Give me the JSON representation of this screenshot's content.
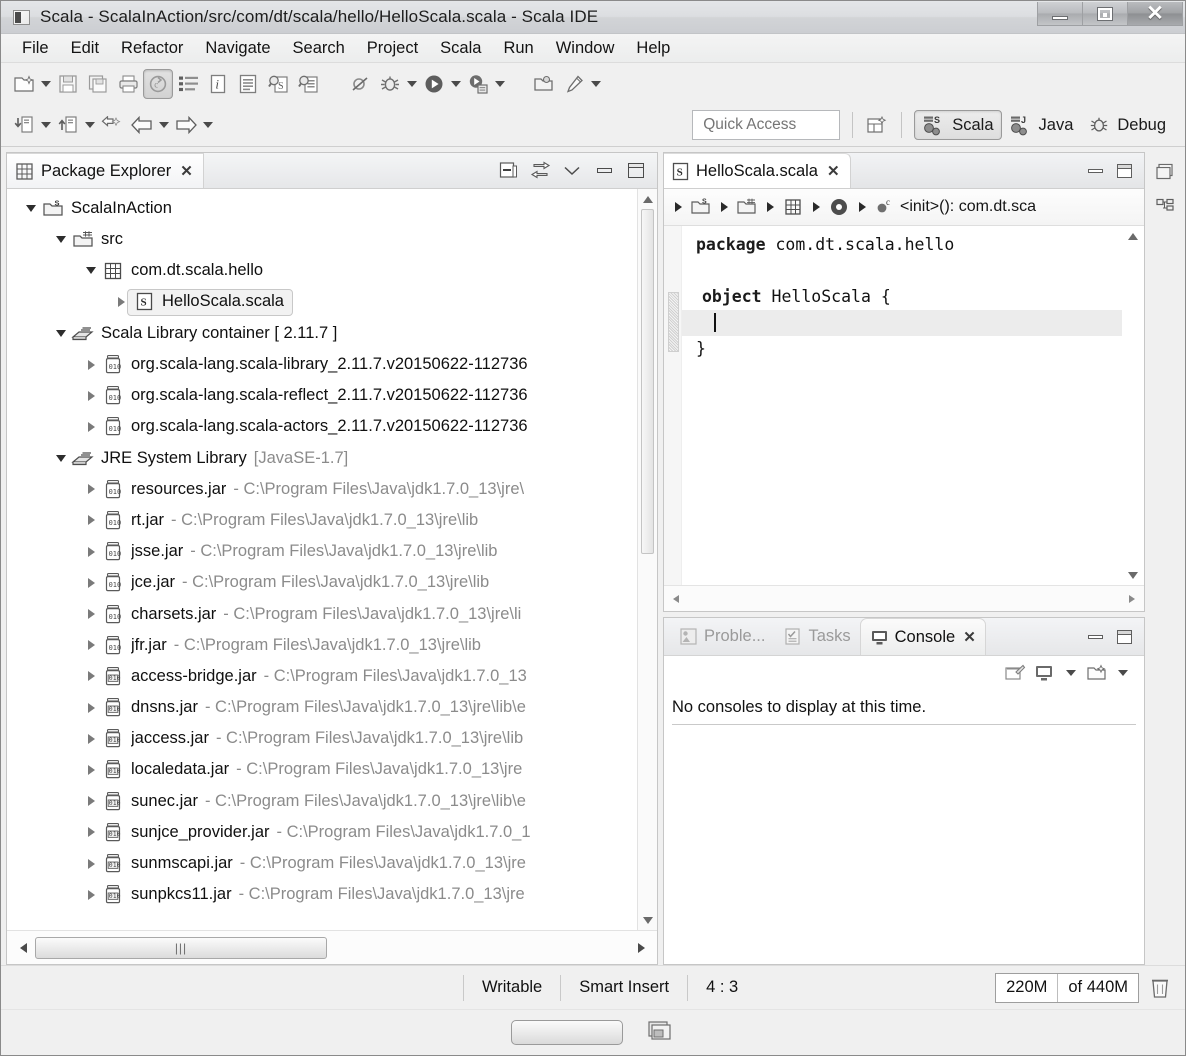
{
  "window": {
    "title": "Scala - ScalaInAction/src/com/dt/scala/hello/HelloScala.scala - Scala IDE",
    "app_icon": "app-window-icon",
    "controls": {
      "minimize": "minimize-icon",
      "maximize": "maximize-icon",
      "close": "✕"
    }
  },
  "menubar": {
    "items": [
      {
        "label": "File"
      },
      {
        "label": "Edit"
      },
      {
        "label": "Refactor"
      },
      {
        "label": "Navigate"
      },
      {
        "label": "Search"
      },
      {
        "label": "Project"
      },
      {
        "label": "Scala"
      },
      {
        "label": "Run"
      },
      {
        "label": "Window"
      },
      {
        "label": "Help"
      }
    ]
  },
  "toolbar": {
    "row1": [
      {
        "name": "new-wizard-button",
        "icon": "new-file-icon",
        "dropdown": true,
        "pressed": false
      },
      {
        "name": "save-button",
        "icon": "save-icon",
        "dropdown": false,
        "pressed": false
      },
      {
        "name": "save-all-button",
        "icon": "save-all-icon",
        "dropdown": false,
        "pressed": false
      },
      {
        "name": "print-button",
        "icon": "print-icon",
        "dropdown": false,
        "pressed": false
      },
      {
        "name": "build-all-button",
        "icon": "build-icon",
        "dropdown": false,
        "pressed": true
      },
      {
        "name": "toggle-markers-button",
        "icon": "list-icon",
        "dropdown": false,
        "pressed": false
      },
      {
        "name": "open-task-button",
        "icon": "info-icon",
        "dropdown": false,
        "pressed": false
      },
      {
        "name": "new-scala-file-button",
        "icon": "document-icon",
        "dropdown": false,
        "pressed": false
      },
      {
        "name": "search-type-button",
        "icon": "search-type-icon",
        "dropdown": false,
        "pressed": false
      },
      {
        "name": "search-package-button",
        "icon": "search-package-icon",
        "dropdown": false,
        "pressed": false
      }
    ],
    "row1_right": [
      {
        "name": "skip-breakpoints-button",
        "icon": "skip-breakpoints-icon",
        "dropdown": false
      },
      {
        "name": "debug-button",
        "icon": "debug-bug-icon",
        "dropdown": true
      },
      {
        "name": "run-button",
        "icon": "run-play-icon",
        "dropdown": true
      },
      {
        "name": "external-tools-button",
        "icon": "external-tools-icon",
        "dropdown": true
      },
      {
        "name": "open-perspective-button",
        "icon": "open-perspective-icon",
        "dropdown": false
      },
      {
        "name": "pin-editor-button",
        "icon": "pin-icon",
        "dropdown": true
      }
    ],
    "row2": [
      {
        "name": "new-scala-project-button",
        "icon": "scala-project-down-icon",
        "dropdown": true
      },
      {
        "name": "new-scala-class-button",
        "icon": "scala-class-up-icon",
        "dropdown": true
      },
      {
        "name": "previous-annotation-button",
        "icon": "prev-annotation-icon",
        "dropdown": false
      },
      {
        "name": "back-button",
        "icon": "back-arrow-icon",
        "dropdown": true
      },
      {
        "name": "forward-button",
        "icon": "forward-arrow-icon",
        "dropdown": true
      }
    ]
  },
  "quick_access": {
    "placeholder": "Quick Access",
    "value": ""
  },
  "perspectives": {
    "open_perspective_icon": "open-perspective-icon",
    "items": [
      {
        "label": "Scala",
        "icon": "scala-perspective-icon",
        "active": true
      },
      {
        "label": "Java",
        "icon": "java-perspective-icon",
        "active": false
      },
      {
        "label": "Debug",
        "icon": "debug-perspective-icon",
        "active": false
      }
    ]
  },
  "package_explorer": {
    "title": "Package Explorer",
    "tab_close": "✕",
    "tools": [
      {
        "name": "collapse-all-button",
        "icon": "collapse-all-icon"
      },
      {
        "name": "link-with-editor-button",
        "icon": "link-editor-icon"
      },
      {
        "name": "view-menu-button",
        "icon": "chevron-down-icon"
      },
      {
        "name": "minimize-view-button",
        "icon": "minimize-icon"
      },
      {
        "name": "maximize-view-button",
        "icon": "maximize-icon"
      }
    ],
    "tree": [
      {
        "depth": 0,
        "arrow": "down",
        "icon": "scala-project-icon",
        "label": "ScalaInAction",
        "detail": "",
        "selected": false
      },
      {
        "depth": 1,
        "arrow": "down",
        "icon": "source-folder-icon",
        "label": "src",
        "detail": "",
        "selected": false
      },
      {
        "depth": 2,
        "arrow": "down",
        "icon": "package-icon",
        "label": "com.dt.scala.hello",
        "detail": "",
        "selected": false
      },
      {
        "depth": 3,
        "arrow": "right",
        "icon": "scala-file-icon",
        "label": "HelloScala.scala",
        "detail": "",
        "selected": true
      },
      {
        "depth": 1,
        "arrow": "down",
        "icon": "library-icon",
        "label": "Scala Library container [ 2.11.7 ]",
        "detail": "",
        "selected": false
      },
      {
        "depth": 2,
        "arrow": "right",
        "icon": "jar-icon",
        "label": "org.scala-lang.scala-library_2.11.7.v20150622-112736",
        "detail": "",
        "selected": false
      },
      {
        "depth": 2,
        "arrow": "right",
        "icon": "jar-icon",
        "label": "org.scala-lang.scala-reflect_2.11.7.v20150622-112736",
        "detail": "",
        "selected": false
      },
      {
        "depth": 2,
        "arrow": "right",
        "icon": "jar-icon",
        "label": "org.scala-lang.scala-actors_2.11.7.v20150622-112736",
        "detail": "",
        "selected": false
      },
      {
        "depth": 1,
        "arrow": "down",
        "icon": "library-icon",
        "label": "JRE System Library",
        "detail": "[JavaSE-1.7]",
        "selected": false
      },
      {
        "depth": 2,
        "arrow": "right",
        "icon": "jar-icon",
        "label": "resources.jar",
        "detail": "- C:\\Program Files\\Java\\jdk1.7.0_13\\jre\\",
        "selected": false
      },
      {
        "depth": 2,
        "arrow": "right",
        "icon": "jar-icon",
        "label": "rt.jar",
        "detail": "- C:\\Program Files\\Java\\jdk1.7.0_13\\jre\\lib",
        "selected": false
      },
      {
        "depth": 2,
        "arrow": "right",
        "icon": "jar-icon",
        "label": "jsse.jar",
        "detail": "- C:\\Program Files\\Java\\jdk1.7.0_13\\jre\\lib",
        "selected": false
      },
      {
        "depth": 2,
        "arrow": "right",
        "icon": "jar-icon",
        "label": "jce.jar",
        "detail": "- C:\\Program Files\\Java\\jdk1.7.0_13\\jre\\lib",
        "selected": false
      },
      {
        "depth": 2,
        "arrow": "right",
        "icon": "jar-icon",
        "label": "charsets.jar",
        "detail": "- C:\\Program Files\\Java\\jdk1.7.0_13\\jre\\li",
        "selected": false
      },
      {
        "depth": 2,
        "arrow": "right",
        "icon": "jar-icon",
        "label": "jfr.jar",
        "detail": "- C:\\Program Files\\Java\\jdk1.7.0_13\\jre\\lib",
        "selected": false
      },
      {
        "depth": 2,
        "arrow": "right",
        "icon": "jar-ext-icon",
        "label": "access-bridge.jar",
        "detail": "- C:\\Program Files\\Java\\jdk1.7.0_13",
        "selected": false
      },
      {
        "depth": 2,
        "arrow": "right",
        "icon": "jar-ext-icon",
        "label": "dnsns.jar",
        "detail": "- C:\\Program Files\\Java\\jdk1.7.0_13\\jre\\lib\\e",
        "selected": false
      },
      {
        "depth": 2,
        "arrow": "right",
        "icon": "jar-ext-icon",
        "label": "jaccess.jar",
        "detail": "- C:\\Program Files\\Java\\jdk1.7.0_13\\jre\\lib",
        "selected": false
      },
      {
        "depth": 2,
        "arrow": "right",
        "icon": "jar-ext-icon",
        "label": "localedata.jar",
        "detail": "- C:\\Program Files\\Java\\jdk1.7.0_13\\jre",
        "selected": false
      },
      {
        "depth": 2,
        "arrow": "right",
        "icon": "jar-ext-icon",
        "label": "sunec.jar",
        "detail": "- C:\\Program Files\\Java\\jdk1.7.0_13\\jre\\lib\\e",
        "selected": false
      },
      {
        "depth": 2,
        "arrow": "right",
        "icon": "jar-ext-icon",
        "label": "sunjce_provider.jar",
        "detail": "- C:\\Program Files\\Java\\jdk1.7.0_1",
        "selected": false
      },
      {
        "depth": 2,
        "arrow": "right",
        "icon": "jar-ext-icon",
        "label": "sunmscapi.jar",
        "detail": "- C:\\Program Files\\Java\\jdk1.7.0_13\\jre",
        "selected": false
      },
      {
        "depth": 2,
        "arrow": "right",
        "icon": "jar-ext-icon",
        "label": "sunpkcs11.jar",
        "detail": "- C:\\Program Files\\Java\\jdk1.7.0_13\\jre",
        "selected": false
      }
    ]
  },
  "editor": {
    "tab": {
      "label": "HelloScala.scala",
      "icon": "scala-file-icon",
      "close": "✕"
    },
    "pane_buttons": [
      {
        "name": "minimize-editor-button",
        "icon": "minimize-icon"
      },
      {
        "name": "maximize-editor-button",
        "icon": "maximize-icon"
      }
    ],
    "breadcrumb": [
      {
        "icon": "scala-project-icon",
        "label": ""
      },
      {
        "icon": "source-folder-icon",
        "label": ""
      },
      {
        "icon": "package-icon",
        "label": ""
      },
      {
        "icon": "object-icon",
        "label": ""
      },
      {
        "icon": "constructor-icon",
        "label": "<init>(): com.dt.sca"
      }
    ],
    "code_lines": [
      {
        "text": "package com.dt.scala.hello",
        "keyword": "package",
        "rest": " com.dt.scala.hello",
        "highlight": false,
        "fold": false
      },
      {
        "text": "",
        "keyword": "",
        "rest": "",
        "highlight": false,
        "fold": false
      },
      {
        "text": "object HelloScala {",
        "keyword": "object",
        "rest": " HelloScala {",
        "highlight": false,
        "fold": true
      },
      {
        "text": "",
        "keyword": "",
        "rest": "",
        "highlight": true,
        "fold": false,
        "caret": true
      },
      {
        "text": "}",
        "keyword": "",
        "rest": "}",
        "highlight": false,
        "fold": false
      }
    ]
  },
  "bottom_panel": {
    "tabs": [
      {
        "label": "Proble...",
        "icon": "problems-icon",
        "active": false
      },
      {
        "label": "Tasks",
        "icon": "tasks-icon",
        "active": false
      },
      {
        "label": "Console",
        "icon": "console-icon",
        "active": true,
        "close": "✕"
      }
    ],
    "pane_buttons": [
      {
        "name": "minimize-console-button",
        "icon": "minimize-icon"
      },
      {
        "name": "maximize-console-button",
        "icon": "maximize-icon"
      }
    ],
    "toolbar": [
      {
        "name": "clear-console-button",
        "icon": "clear-console-icon",
        "dropdown": false
      },
      {
        "name": "display-selected-console-button",
        "icon": "display-console-icon",
        "dropdown": true
      },
      {
        "name": "open-console-button",
        "icon": "open-console-icon",
        "dropdown": true
      }
    ],
    "message": "No consoles to display at this time."
  },
  "status_bar": {
    "writable": "Writable",
    "insert_mode": "Smart Insert",
    "position": "4 : 3",
    "heap_used": "220M",
    "heap_of": "of 440M",
    "trash_icon": "trash-icon"
  },
  "taskbar": {
    "button_icon": "window-button",
    "tile_icon": "tile-windows-icon"
  },
  "colors": {
    "accent": "#cde3f7",
    "window_bg": "#f0f0f0",
    "pane_bg": "#ffffff",
    "text": "#111111",
    "dim_text": "#8b8b8b",
    "border": "#c6c6c6"
  }
}
